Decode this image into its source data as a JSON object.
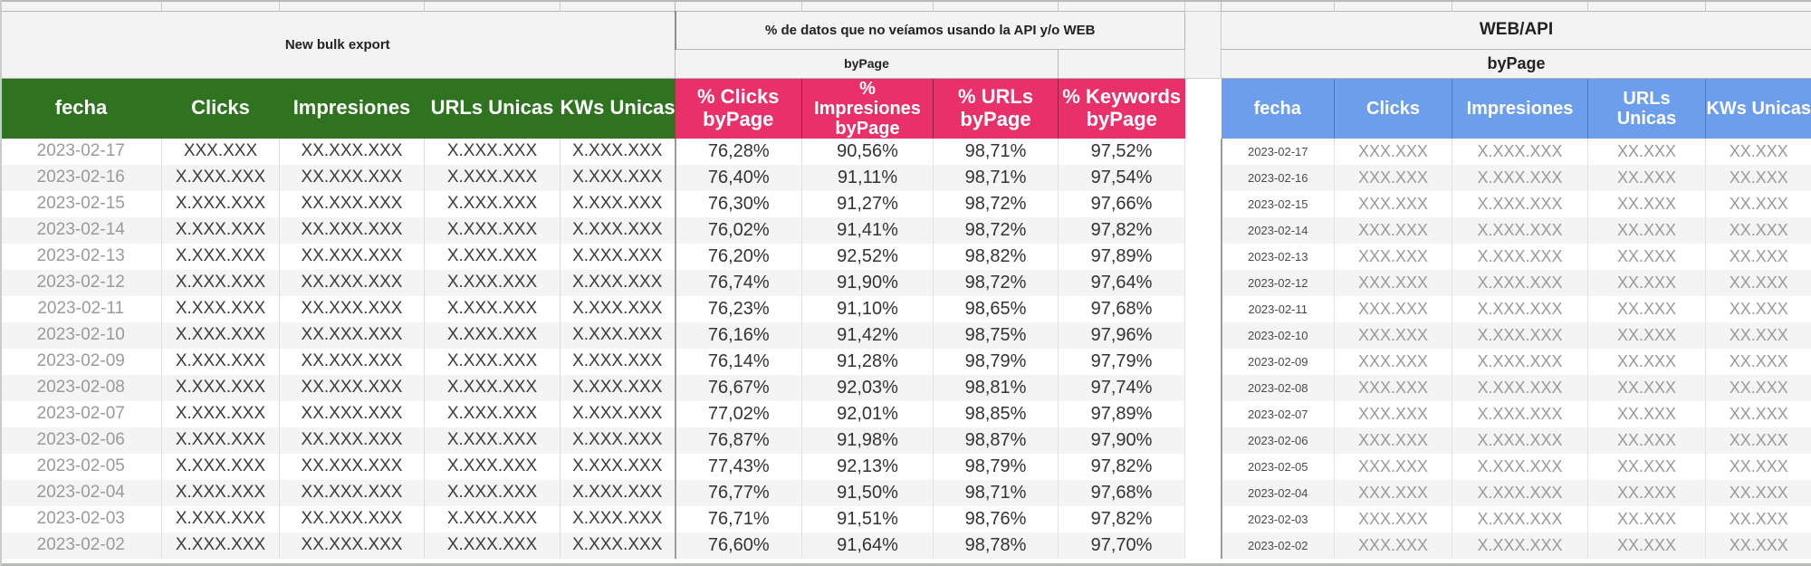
{
  "groups": {
    "left_title": "New bulk export",
    "middle_title": "% de datos que no veíamos usando la API y/o WEB",
    "middle_sub": "byPage",
    "right_title": "WEB/API",
    "right_sub": "byPage"
  },
  "headers": {
    "left": [
      "fecha",
      "Clicks",
      "Impresiones",
      "URLs Unicas",
      "KWs Unicas"
    ],
    "middle": [
      "% Clicks byPage",
      "% Impresiones byPage",
      "% URLs byPage",
      "% Keywords byPage"
    ],
    "middle_lines": [
      [
        "% Clicks",
        "byPage"
      ],
      [
        "%",
        "Impresiones",
        "byPage"
      ],
      [
        "% URLs",
        "byPage"
      ],
      [
        "% Keywords",
        "byPage"
      ]
    ],
    "right": [
      "fecha",
      "Clicks",
      "Impresiones",
      "URLs Unicas",
      "KWs Unicas"
    ],
    "right_lines": [
      [
        "fecha"
      ],
      [
        "Clicks"
      ],
      [
        "Impresiones"
      ],
      [
        "URLs",
        "Unicas"
      ],
      [
        "KWs Unicas"
      ]
    ]
  },
  "colors": {
    "green": "#2f7320",
    "pink": "#e8306b",
    "blue": "#6d9eeb",
    "banner_bg": "#f3f3f3",
    "row_alt": "#f4f4f4"
  },
  "chart_data": {
    "type": "table",
    "title": "New bulk export vs WEB/API byPage coverage",
    "columns": [
      "fecha",
      "Clicks",
      "Impresiones",
      "URLs Unicas",
      "KWs Unicas",
      "% Clicks byPage",
      "% Impresiones byPage",
      "% URLs byPage",
      "% Keywords byPage",
      "fecha (WEB/API)",
      "Clicks (WEB/API)",
      "Impresiones (WEB/API)",
      "URLs Unicas (WEB/API)",
      "KWs Unicas (WEB/API)"
    ],
    "rows": [
      {
        "fecha": "2023-02-17",
        "clicks": "XXX.XXX",
        "impresiones": "XX.XXX.XXX",
        "urls": "X.XXX.XXX",
        "kws": "X.XXX.XXX",
        "pct_clicks": "76,28%",
        "pct_impresiones": "90,56%",
        "pct_urls": "98,71%",
        "pct_keywords": "97,52%",
        "r_fecha": "2023-02-17",
        "r_clicks": "XXX.XXX",
        "r_impresiones": "X.XXX.XXX",
        "r_urls": "XX.XXX",
        "r_kws": "XX.XXX"
      },
      {
        "fecha": "2023-02-16",
        "clicks": "X.XXX.XXX",
        "impresiones": "XX.XXX.XXX",
        "urls": "X.XXX.XXX",
        "kws": "X.XXX.XXX",
        "pct_clicks": "76,40%",
        "pct_impresiones": "91,11%",
        "pct_urls": "98,71%",
        "pct_keywords": "97,54%",
        "r_fecha": "2023-02-16",
        "r_clicks": "XXX.XXX",
        "r_impresiones": "X.XXX.XXX",
        "r_urls": "XX.XXX",
        "r_kws": "XX.XXX"
      },
      {
        "fecha": "2023-02-15",
        "clicks": "X.XXX.XXX",
        "impresiones": "XX.XXX.XXX",
        "urls": "X.XXX.XXX",
        "kws": "X.XXX.XXX",
        "pct_clicks": "76,30%",
        "pct_impresiones": "91,27%",
        "pct_urls": "98,72%",
        "pct_keywords": "97,66%",
        "r_fecha": "2023-02-15",
        "r_clicks": "XXX.XXX",
        "r_impresiones": "X.XXX.XXX",
        "r_urls": "XX.XXX",
        "r_kws": "XX.XXX"
      },
      {
        "fecha": "2023-02-14",
        "clicks": "X.XXX.XXX",
        "impresiones": "XX.XXX.XXX",
        "urls": "X.XXX.XXX",
        "kws": "X.XXX.XXX",
        "pct_clicks": "76,02%",
        "pct_impresiones": "91,41%",
        "pct_urls": "98,72%",
        "pct_keywords": "97,82%",
        "r_fecha": "2023-02-14",
        "r_clicks": "XXX.XXX",
        "r_impresiones": "X.XXX.XXX",
        "r_urls": "XX.XXX",
        "r_kws": "XX.XXX"
      },
      {
        "fecha": "2023-02-13",
        "clicks": "X.XXX.XXX",
        "impresiones": "XX.XXX.XXX",
        "urls": "X.XXX.XXX",
        "kws": "X.XXX.XXX",
        "pct_clicks": "76,20%",
        "pct_impresiones": "92,52%",
        "pct_urls": "98,82%",
        "pct_keywords": "97,89%",
        "r_fecha": "2023-02-13",
        "r_clicks": "XXX.XXX",
        "r_impresiones": "X.XXX.XXX",
        "r_urls": "XX.XXX",
        "r_kws": "XX.XXX"
      },
      {
        "fecha": "2023-02-12",
        "clicks": "X.XXX.XXX",
        "impresiones": "XX.XXX.XXX",
        "urls": "X.XXX.XXX",
        "kws": "X.XXX.XXX",
        "pct_clicks": "76,74%",
        "pct_impresiones": "91,90%",
        "pct_urls": "98,72%",
        "pct_keywords": "97,64%",
        "r_fecha": "2023-02-12",
        "r_clicks": "XXX.XXX",
        "r_impresiones": "X.XXX.XXX",
        "r_urls": "XX.XXX",
        "r_kws": "XX.XXX"
      },
      {
        "fecha": "2023-02-11",
        "clicks": "X.XXX.XXX",
        "impresiones": "XX.XXX.XXX",
        "urls": "X.XXX.XXX",
        "kws": "X.XXX.XXX",
        "pct_clicks": "76,23%",
        "pct_impresiones": "91,10%",
        "pct_urls": "98,65%",
        "pct_keywords": "97,68%",
        "r_fecha": "2023-02-11",
        "r_clicks": "XXX.XXX",
        "r_impresiones": "X.XXX.XXX",
        "r_urls": "XX.XXX",
        "r_kws": "XX.XXX"
      },
      {
        "fecha": "2023-02-10",
        "clicks": "X.XXX.XXX",
        "impresiones": "XX.XXX.XXX",
        "urls": "X.XXX.XXX",
        "kws": "X.XXX.XXX",
        "pct_clicks": "76,16%",
        "pct_impresiones": "91,42%",
        "pct_urls": "98,75%",
        "pct_keywords": "97,96%",
        "r_fecha": "2023-02-10",
        "r_clicks": "XXX.XXX",
        "r_impresiones": "X.XXX.XXX",
        "r_urls": "XX.XXX",
        "r_kws": "XX.XXX"
      },
      {
        "fecha": "2023-02-09",
        "clicks": "X.XXX.XXX",
        "impresiones": "XX.XXX.XXX",
        "urls": "X.XXX.XXX",
        "kws": "X.XXX.XXX",
        "pct_clicks": "76,14%",
        "pct_impresiones": "91,28%",
        "pct_urls": "98,79%",
        "pct_keywords": "97,79%",
        "r_fecha": "2023-02-09",
        "r_clicks": "XXX.XXX",
        "r_impresiones": "X.XXX.XXX",
        "r_urls": "XX.XXX",
        "r_kws": "XX.XXX"
      },
      {
        "fecha": "2023-02-08",
        "clicks": "X.XXX.XXX",
        "impresiones": "XX.XXX.XXX",
        "urls": "X.XXX.XXX",
        "kws": "X.XXX.XXX",
        "pct_clicks": "76,67%",
        "pct_impresiones": "92,03%",
        "pct_urls": "98,81%",
        "pct_keywords": "97,74%",
        "r_fecha": "2023-02-08",
        "r_clicks": "XXX.XXX",
        "r_impresiones": "X.XXX.XXX",
        "r_urls": "XX.XXX",
        "r_kws": "XX.XXX"
      },
      {
        "fecha": "2023-02-07",
        "clicks": "X.XXX.XXX",
        "impresiones": "XX.XXX.XXX",
        "urls": "X.XXX.XXX",
        "kws": "X.XXX.XXX",
        "pct_clicks": "77,02%",
        "pct_impresiones": "92,01%",
        "pct_urls": "98,85%",
        "pct_keywords": "97,89%",
        "r_fecha": "2023-02-07",
        "r_clicks": "XXX.XXX",
        "r_impresiones": "X.XXX.XXX",
        "r_urls": "XX.XXX",
        "r_kws": "XX.XXX"
      },
      {
        "fecha": "2023-02-06",
        "clicks": "X.XXX.XXX",
        "impresiones": "XX.XXX.XXX",
        "urls": "X.XXX.XXX",
        "kws": "X.XXX.XXX",
        "pct_clicks": "76,87%",
        "pct_impresiones": "91,98%",
        "pct_urls": "98,87%",
        "pct_keywords": "97,90%",
        "r_fecha": "2023-02-06",
        "r_clicks": "XXX.XXX",
        "r_impresiones": "X.XXX.XXX",
        "r_urls": "XX.XXX",
        "r_kws": "XX.XXX"
      },
      {
        "fecha": "2023-02-05",
        "clicks": "X.XXX.XXX",
        "impresiones": "XX.XXX.XXX",
        "urls": "X.XXX.XXX",
        "kws": "X.XXX.XXX",
        "pct_clicks": "77,43%",
        "pct_impresiones": "92,13%",
        "pct_urls": "98,79%",
        "pct_keywords": "97,82%",
        "r_fecha": "2023-02-05",
        "r_clicks": "XXX.XXX",
        "r_impresiones": "X.XXX.XXX",
        "r_urls": "XX.XXX",
        "r_kws": "XX.XXX"
      },
      {
        "fecha": "2023-02-04",
        "clicks": "X.XXX.XXX",
        "impresiones": "XX.XXX.XXX",
        "urls": "X.XXX.XXX",
        "kws": "X.XXX.XXX",
        "pct_clicks": "76,77%",
        "pct_impresiones": "91,50%",
        "pct_urls": "98,71%",
        "pct_keywords": "97,68%",
        "r_fecha": "2023-02-04",
        "r_clicks": "XXX.XXX",
        "r_impresiones": "X.XXX.XXX",
        "r_urls": "XX.XXX",
        "r_kws": "XX.XXX"
      },
      {
        "fecha": "2023-02-03",
        "clicks": "X.XXX.XXX",
        "impresiones": "XX.XXX.XXX",
        "urls": "X.XXX.XXX",
        "kws": "X.XXX.XXX",
        "pct_clicks": "76,71%",
        "pct_impresiones": "91,51%",
        "pct_urls": "98,76%",
        "pct_keywords": "97,82%",
        "r_fecha": "2023-02-03",
        "r_clicks": "XXX.XXX",
        "r_impresiones": "X.XXX.XXX",
        "r_urls": "XX.XXX",
        "r_kws": "XX.XXX"
      },
      {
        "fecha": "2023-02-02",
        "clicks": "X.XXX.XXX",
        "impresiones": "XX.XXX.XXX",
        "urls": "X.XXX.XXX",
        "kws": "X.XXX.XXX",
        "pct_clicks": "76,60%",
        "pct_impresiones": "91,64%",
        "pct_urls": "98,78%",
        "pct_keywords": "97,70%",
        "r_fecha": "2023-02-02",
        "r_clicks": "XXX.XXX",
        "r_impresiones": "X.XXX.XXX",
        "r_urls": "XX.XXX",
        "r_kws": "XX.XXX"
      }
    ]
  }
}
